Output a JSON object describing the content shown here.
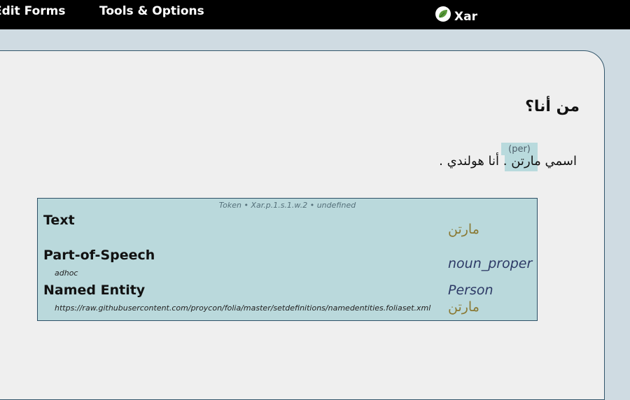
{
  "menu": {
    "edit_forms": "Edit Forms",
    "tools_options": "Tools & Options"
  },
  "brand": {
    "name": "Xar",
    "logo_icon": "leaf-icon"
  },
  "document": {
    "title": "من أنا؟",
    "sentence": {
      "before": "اسمي",
      "highlighted": "مارتن",
      "after": ". أنا هولندي ."
    },
    "entity_tag": "(per)"
  },
  "token_panel": {
    "header": "Token • Xar.p.1.s.1.w.2 • undefined",
    "fields": [
      {
        "label": "Text",
        "sub": "",
        "value": "مارتن",
        "value2": ""
      },
      {
        "label": "Part-of-Speech",
        "sub": "adhoc",
        "value": "noun_proper",
        "value2": ""
      },
      {
        "label": "Named Entity",
        "sub": "https://raw.githubusercontent.com/proycon/folia/master/setdefinitions/namedentities.foliaset.xml",
        "value": "Person",
        "value2": "مارتن"
      }
    ]
  },
  "colors": {
    "topbar": "#000000",
    "background": "#cfdbe2",
    "card": "#efefef",
    "highlight": "#b9dadd",
    "panel_border": "#2d4f66",
    "olive_text": "#8a7a35",
    "navy_text": "#2d3a66"
  }
}
